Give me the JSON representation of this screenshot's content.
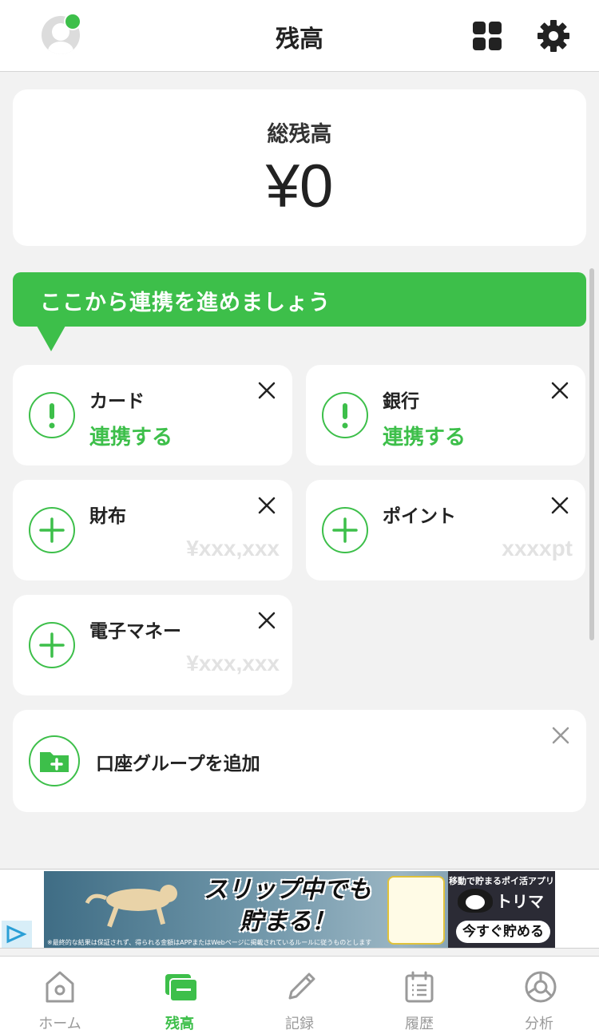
{
  "header": {
    "title": "残高"
  },
  "total": {
    "label": "総残高",
    "value": "¥0"
  },
  "banner": {
    "text": "ここから連携を進めましょう"
  },
  "accounts": [
    {
      "name": "カード",
      "action": "連携する"
    },
    {
      "name": "銀行",
      "action": "連携する"
    },
    {
      "name": "財布",
      "placeholder": "¥xxx,xxx"
    },
    {
      "name": "ポイント",
      "placeholder": "xxxxpt"
    },
    {
      "name": "電子マネー",
      "placeholder": "¥xxx,xxx"
    }
  ],
  "group": {
    "label": "口座グループを追加"
  },
  "ad": {
    "headline_line1": "スリップ中でも",
    "headline_line2": "貯まる！",
    "brand_tagline": "移動で貯まるポイ活アプリ",
    "brand_name": "トリマ",
    "cta": "今すぐ貯める",
    "fineprint": "※最終的な結果は保証されず、得られる金額はAPPまたはWebページに掲載されているルールに従うものとします"
  },
  "tabs": [
    {
      "label": "ホーム",
      "icon": "home-icon",
      "active": false
    },
    {
      "label": "残高",
      "icon": "wallet-icon",
      "active": true
    },
    {
      "label": "記録",
      "icon": "pencil-icon",
      "active": false
    },
    {
      "label": "履歴",
      "icon": "calendar-list-icon",
      "active": false
    },
    {
      "label": "分析",
      "icon": "pie-chart-icon",
      "active": false
    }
  ],
  "colors": {
    "accent": "#3dbf4a",
    "background": "#f2f2f2",
    "placeholder": "#e2e2e2"
  }
}
